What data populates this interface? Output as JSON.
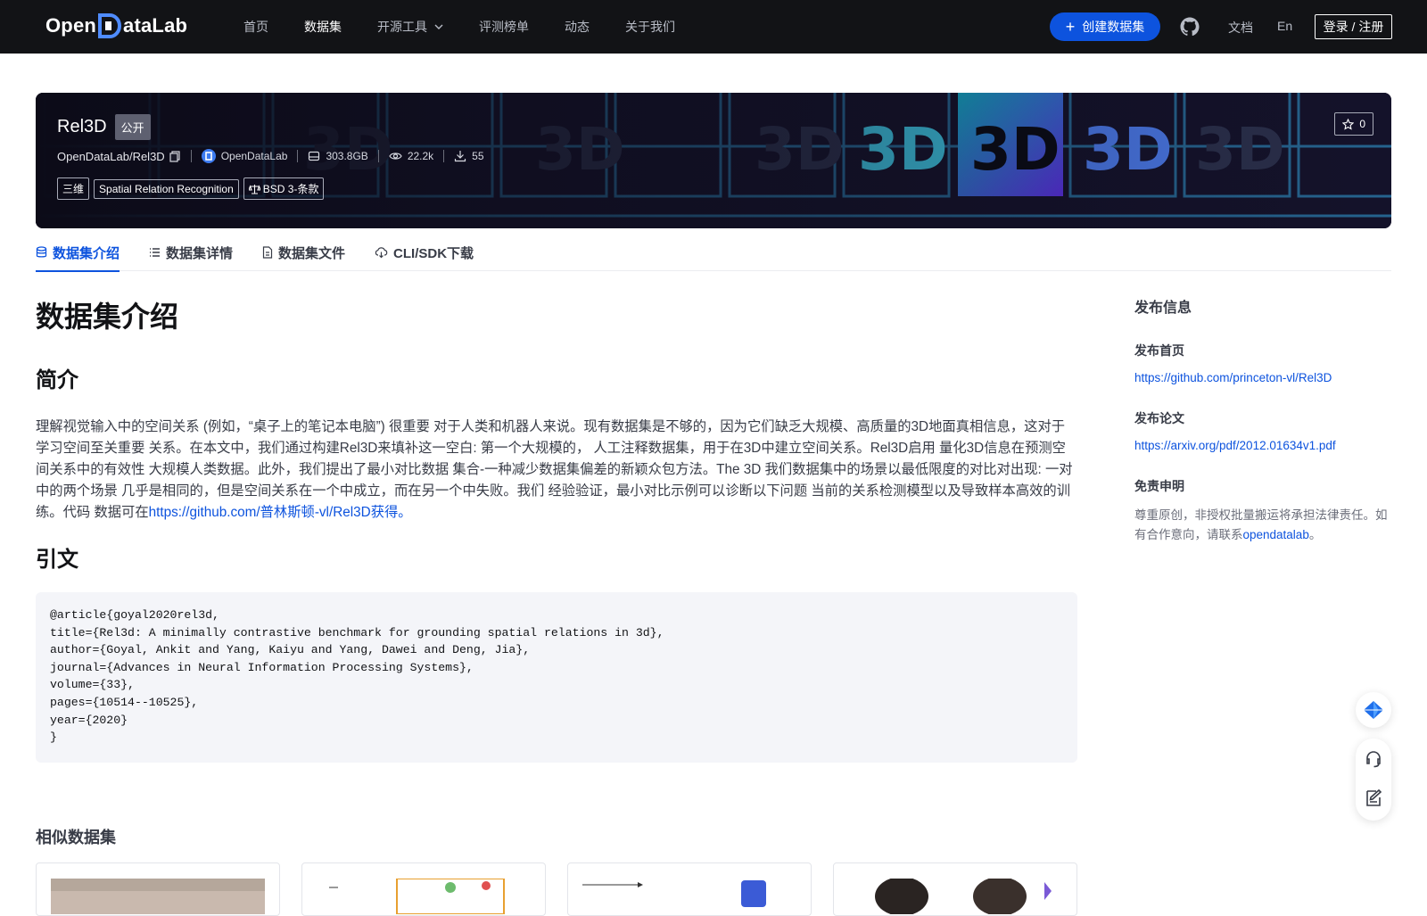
{
  "nav": {
    "logo": {
      "prefix": "Open",
      "suffix": "ataLab"
    },
    "items": [
      {
        "label": "首页",
        "active": false
      },
      {
        "label": "数据集",
        "active": true
      },
      {
        "label": "开源工具",
        "active": false,
        "dropdown": true
      },
      {
        "label": "评测榜单",
        "active": false
      },
      {
        "label": "动态",
        "active": false
      },
      {
        "label": "关于我们",
        "active": false
      }
    ],
    "create_label": "创建数据集",
    "docs_label": "文档",
    "lang_label": "En",
    "login_label": "登录 / 注册"
  },
  "dataset": {
    "name": "Rel3D",
    "visibility": "公开",
    "path": "OpenDataLab/Rel3D",
    "publisher": "OpenDataLab",
    "size": "303.8GB",
    "views": "22.2k",
    "downloads": "55",
    "tags": [
      "三维",
      "Spatial Relation Recognition",
      "BSD 3-条款"
    ],
    "stars": "0",
    "banner_text": "3D"
  },
  "tabs": [
    {
      "label": "数据集介绍",
      "icon": "database-icon",
      "active": true
    },
    {
      "label": "数据集详情",
      "icon": "list-icon",
      "active": false
    },
    {
      "label": "数据集文件",
      "icon": "file-icon",
      "active": false
    },
    {
      "label": "CLI/SDK下载",
      "icon": "cloud-download-icon",
      "active": false
    }
  ],
  "intro": {
    "heading": "数据集介绍",
    "summary_heading": "简介",
    "summary_text": "理解视觉输入中的空间关系 (例如，“桌子上的笔记本电脑”) 很重要 对于人类和机器人来说。现有数据集是不够的，因为它们缺乏大规模、高质量的3D地面真相信息，这对于学习空间至关重要 关系。在本文中，我们通过构建Rel3D来填补这一空白: 第一个大规模的， 人工注释数据集，用于在3D中建立空间关系。Rel3D启用 量化3D信息在预测空间关系中的有效性 大规模人类数据。此外，我们提出了最小对比数据 集合-一种减少数据集偏差的新颖众包方法。The 3D 我们数据集中的场景以最低限度的对比对出现: 一对中的两个场景 几乎是相同的，但是空间关系在一个中成立，而在另一个中失败。我们 经验验证，最小对比示例可以诊断以下问题 当前的关系检测模型以及导致样本高效的训练。代码 数据可在",
    "summary_link": "https://github.com/普林斯顿-vl/Rel3D获得。",
    "citation_heading": "引文",
    "citation": "@article{goyal2020rel3d,\ntitle={Rel3d: A minimally contrastive benchmark for grounding spatial relations in 3d},\nauthor={Goyal, Ankit and Yang, Kaiyu and Yang, Dawei and Deng, Jia},\njournal={Advances in Neural Information Processing Systems},\nvolume={33},\npages={10514--10525},\nyear={2020}\n}"
  },
  "similar": {
    "heading": "相似数据集"
  },
  "sidebar": {
    "heading": "发布信息",
    "homepage_label": "发布首页",
    "homepage_url": "https://github.com/princeton-vl/Rel3D",
    "paper_label": "发布论文",
    "paper_url": "https://arxiv.org/pdf/2012.01634v1.pdf",
    "disclaimer_label": "免责申明",
    "disclaimer_text": "尊重原创，非授权批量搬运将承担法律责任。如有合作意向，请联系",
    "disclaimer_link": "opendatalab",
    "disclaimer_end": "。"
  },
  "colors": {
    "brand": "#0d53de",
    "nav_bg": "#121316"
  }
}
